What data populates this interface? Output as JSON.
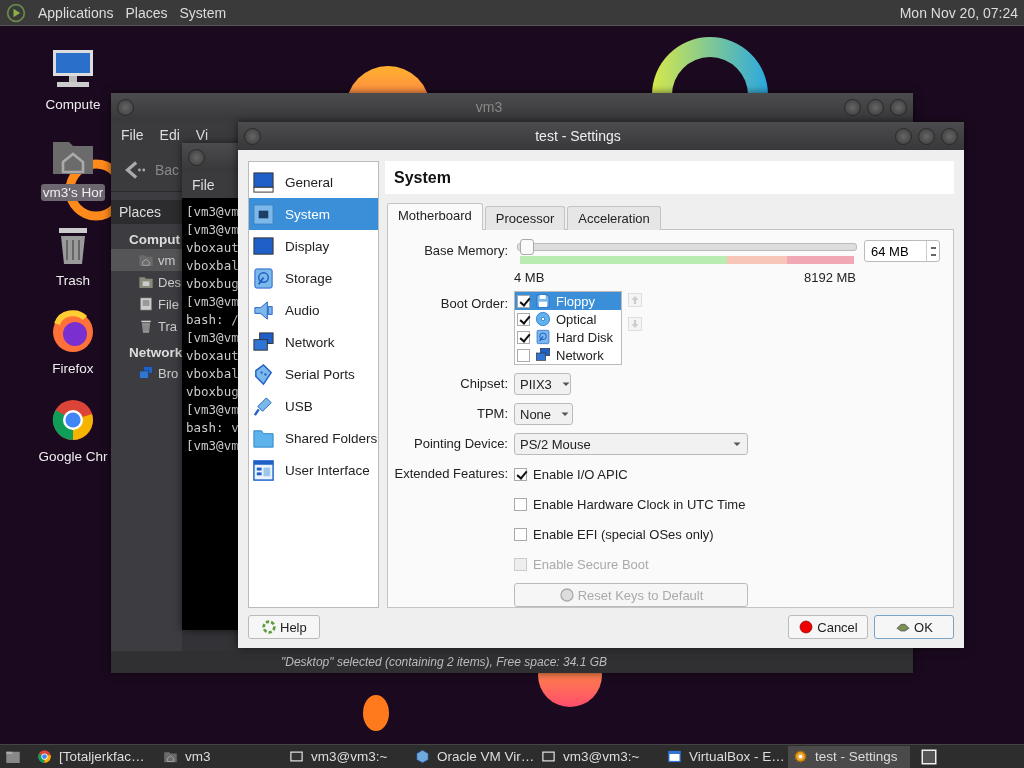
{
  "top_panel": {
    "menus": [
      "Applications",
      "Places",
      "System"
    ],
    "clock": "Mon Nov 20, 07:24"
  },
  "desktop_icons": [
    {
      "label": "Compute",
      "kind": "computer",
      "selected": false
    },
    {
      "label": "vm3's Hor",
      "kind": "home",
      "selected": true
    },
    {
      "label": "Trash",
      "kind": "trash",
      "selected": false
    },
    {
      "label": "Firefox",
      "kind": "firefox",
      "selected": false
    },
    {
      "label": "Google Chr",
      "kind": "chrome",
      "selected": false
    }
  ],
  "file_manager": {
    "title": "vm3",
    "menus": [
      "File",
      "Edi",
      "Vi"
    ],
    "back_label": "Bac",
    "sidebar_title": "Places",
    "sections": [
      {
        "heading": "Comput",
        "items": [
          {
            "label": "vm",
            "kind": "home",
            "selected": true
          },
          {
            "label": "Des",
            "kind": "desktop",
            "selected": false
          },
          {
            "label": "File",
            "kind": "drive",
            "selected": false
          },
          {
            "label": "Tra",
            "kind": "trash",
            "selected": false
          }
        ]
      },
      {
        "heading": "Network",
        "items": [
          {
            "label": "Bro",
            "kind": "network",
            "selected": false
          }
        ]
      }
    ],
    "status": "\"Desktop\" selected (containing 2 items), Free space: 34.1 GB"
  },
  "terminal": {
    "menus": [
      "File"
    ],
    "lines": [
      "[vm3@vm",
      "[vm3@vm",
      "vboxaut",
      "vboxbal",
      "vboxbug",
      "[vm3@vm",
      "bash: /",
      "[vm3@vm",
      "vboxaut",
      "vboxbal",
      "vboxbug",
      "[vm3@vm",
      "bash: v",
      "[vm3@vm"
    ]
  },
  "settings": {
    "title": "test - Settings",
    "sidebar": [
      {
        "label": "General",
        "kind": "general",
        "selected": false
      },
      {
        "label": "System",
        "kind": "system",
        "selected": true
      },
      {
        "label": "Display",
        "kind": "display",
        "selected": false
      },
      {
        "label": "Storage",
        "kind": "storage",
        "selected": false
      },
      {
        "label": "Audio",
        "kind": "audio",
        "selected": false
      },
      {
        "label": "Network",
        "kind": "network",
        "selected": false
      },
      {
        "label": "Serial Ports",
        "kind": "serial",
        "selected": false
      },
      {
        "label": "USB",
        "kind": "usb",
        "selected": false
      },
      {
        "label": "Shared Folders",
        "kind": "folder",
        "selected": false
      },
      {
        "label": "User Interface",
        "kind": "ui",
        "selected": false
      }
    ],
    "header": "System",
    "tabs": [
      {
        "label": "Motherboard",
        "selected": true
      },
      {
        "label": "Processor",
        "selected": false
      },
      {
        "label": "Acceleration",
        "selected": false
      }
    ],
    "base_memory": {
      "label": "Base Memory:",
      "level": 0.0073,
      "min": "4 MB",
      "max": "8192 MB",
      "value": "64 MB"
    },
    "boot_order": {
      "label": "Boot Order:",
      "items": [
        {
          "label": "Floppy",
          "kind": "floppy",
          "checked": true,
          "selected": true
        },
        {
          "label": "Optical",
          "kind": "optical",
          "checked": true,
          "selected": false
        },
        {
          "label": "Hard Disk",
          "kind": "harddisk",
          "checked": true,
          "selected": false
        },
        {
          "label": "Network",
          "kind": "network",
          "checked": false,
          "selected": false
        }
      ]
    },
    "selects": [
      {
        "label": "Chipset:",
        "value": "PIIX3"
      },
      {
        "label": "TPM:",
        "value": "None"
      },
      {
        "label": "Pointing Device:",
        "value": "PS/2 Mouse"
      }
    ],
    "extended_features": {
      "label": "Extended Features:",
      "options": [
        {
          "label": "Enable I/O APIC",
          "checked": true,
          "disabled": false
        },
        {
          "label": "Enable Hardware Clock in UTC Time",
          "checked": false,
          "disabled": false
        },
        {
          "label": "Enable EFI (special OSes only)",
          "checked": false,
          "disabled": false
        },
        {
          "label": "Enable Secure Boot",
          "checked": false,
          "disabled": true
        }
      ],
      "reset_button": {
        "label": "Reset Keys to Default",
        "disabled": true
      }
    },
    "buttons": {
      "help": "Help",
      "cancel": "Cancel",
      "ok": "OK"
    }
  },
  "taskbar": [
    {
      "label": "[Totaljerkfac…",
      "kind": "chrome",
      "selected": false
    },
    {
      "label": "vm3",
      "kind": "home",
      "selected": false
    },
    {
      "label": "vm3@vm3:~",
      "kind": "terminal",
      "selected": false
    },
    {
      "label": "Oracle VM Vir…",
      "kind": "vbox",
      "selected": false
    },
    {
      "label": "vm3@vm3:~",
      "kind": "terminal",
      "selected": false
    },
    {
      "label": "VirtualBox - E…",
      "kind": "window",
      "selected": false
    },
    {
      "label": "test - Settings",
      "kind": "gear",
      "selected": true
    }
  ]
}
